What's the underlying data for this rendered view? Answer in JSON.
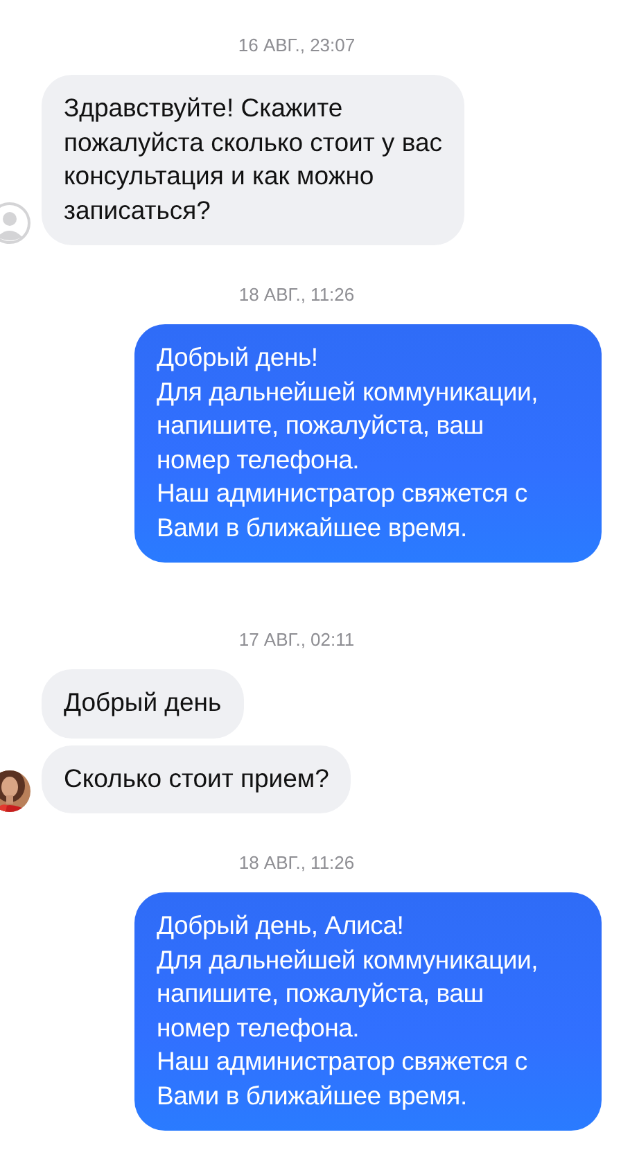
{
  "feed": [
    {
      "kind": "date",
      "text": "16 АВГ., 23:07"
    },
    {
      "kind": "incoming",
      "avatar": {
        "kind": "placeholder"
      },
      "messages": [
        "Здравствуйте! Скажите\nпожалуйста сколько стоит у вас\nконсультация и как можно\nзаписаться?"
      ]
    },
    {
      "kind": "date",
      "text": "18 АВГ., 11:26"
    },
    {
      "kind": "outgoing",
      "messages": [
        "Добрый день!\nДля дальнейшей коммуникации,\nнапишите, пожалуйста, ваш\nномер телефона.\nНаш администратор свяжется с\nВами в ближайшее время."
      ]
    },
    {
      "kind": "date",
      "text": "17 АВГ., 02:11"
    },
    {
      "kind": "incoming",
      "messages": [
        "Добрый день",
        "Сколько стоит прием?"
      ]
    },
    {
      "kind": "date",
      "text": "18 АВГ., 11:26"
    },
    {
      "kind": "outgoing",
      "messages": [
        "Добрый день, Алиса!\nДля дальнейшей коммуникации,\nнапишите, пожалуйста, ваш\nномер телефона.\nНаш администратор свяжется с\nВами в ближайшее время."
      ]
    }
  ]
}
